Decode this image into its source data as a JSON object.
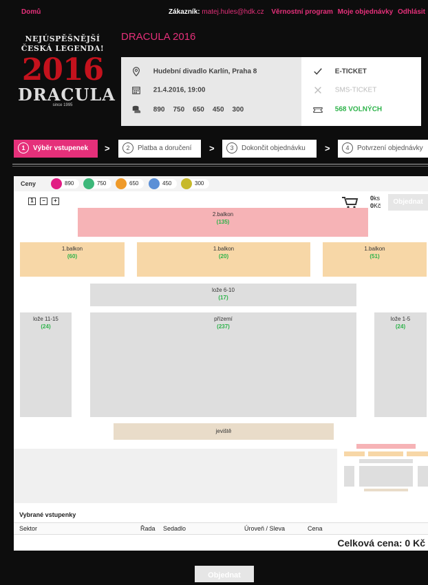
{
  "topbar": {
    "home": "Domů",
    "customer_label": "Zákazník:",
    "email": "matej.hules@hdk.cz",
    "links": [
      "Věrnostní program",
      "Moje objednávky",
      "Odhlásit"
    ]
  },
  "logo": {
    "line1": "NEJÚSPĚŠNĚJŠÍ",
    "line2": "ČESKÁ LEGENDA!",
    "year": "2016",
    "name": "DRACULA",
    "since": "since 1995"
  },
  "event": {
    "title": "DRACULA 2016",
    "venue": "Hudební divadlo Karlín, Praha 8",
    "datetime": "21.4.2016, 19:00",
    "prices": [
      "890",
      "750",
      "650",
      "450",
      "300"
    ],
    "eticket": "E-TICKET",
    "smsticket": "SMS-TICKET",
    "free": "568 VOLNÝCH"
  },
  "steps": [
    {
      "num": "1",
      "label": "Výběr vstupenek"
    },
    {
      "num": "2",
      "label": "Platba a doručení"
    },
    {
      "num": "3",
      "label": "Dokončit objednávku"
    },
    {
      "num": "4",
      "label": "Potvrzení objednávky"
    }
  ],
  "step_sep": ">",
  "price_bar": {
    "label": "Ceny",
    "items": [
      {
        "value": "890",
        "color": "#e11d83"
      },
      {
        "value": "750",
        "color": "#3db87a"
      },
      {
        "value": "650",
        "color": "#ef9a2a"
      },
      {
        "value": "450",
        "color": "#5b8fd6"
      },
      {
        "value": "300",
        "color": "#c7b92b"
      }
    ]
  },
  "zoom": [
    "1",
    "−",
    "+"
  ],
  "cart": {
    "count": "0",
    "count_unit": "ks",
    "price": "0",
    "price_unit": "Kč",
    "order": "Objednat"
  },
  "sections": {
    "balkon2": {
      "name": "2.balkon",
      "count": "(135)"
    },
    "balkon1_left": {
      "name": "1.balkon",
      "count": "(60)"
    },
    "balkon1_mid": {
      "name": "1.balkon",
      "count": "(20)"
    },
    "balkon1_right": {
      "name": "1.balkon",
      "count": "(51)"
    },
    "loze_6_10": {
      "name": "lože 6-10",
      "count": "(17)"
    },
    "loze_11_15": {
      "name": "lože 11-15",
      "count": "(24)"
    },
    "prizemi": {
      "name": "přízemí",
      "count": "(237)"
    },
    "loze_1_5": {
      "name": "lože 1-5",
      "count": "(24)"
    },
    "stage": {
      "name": "jeviště"
    }
  },
  "selected": {
    "title": "Vybrané vstupenky",
    "cols": [
      "Sektor",
      "Řada",
      "Sedadlo",
      "Úroveň / Sleva",
      "Cena"
    ],
    "total": "Celková cena: 0 Kč"
  },
  "order_button": "Objednat"
}
